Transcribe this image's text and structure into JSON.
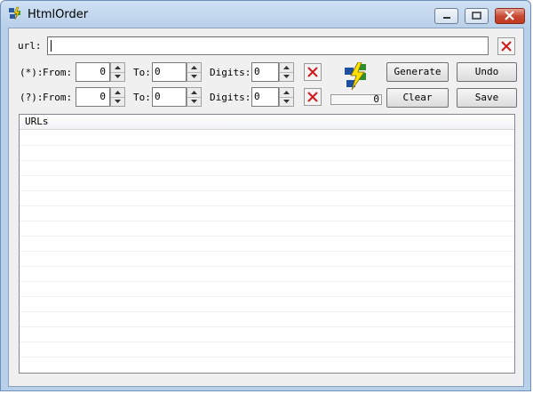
{
  "window": {
    "title": "HtmlOrder"
  },
  "url_row": {
    "label": "url:",
    "value": ""
  },
  "row1": {
    "label": "(*):",
    "from_label": "From:",
    "from_value": "0",
    "to_label": "To:",
    "to_value": "0",
    "digits_label": "Digits:",
    "digits_value": "0"
  },
  "row2": {
    "label": "(?):",
    "from_label": "From:",
    "from_value": "0",
    "to_label": "To:",
    "to_value": "0",
    "digits_label": "Digits:",
    "digits_value": "0"
  },
  "counter": {
    "value": "0"
  },
  "buttons": {
    "generate": "Generate",
    "undo": "Undo",
    "clear": "Clear",
    "save": "Save"
  },
  "list": {
    "column_header": "URLs",
    "items": []
  },
  "colors": {
    "accent_red": "#d21a1a",
    "title_gradient": "#b9d0ea"
  }
}
